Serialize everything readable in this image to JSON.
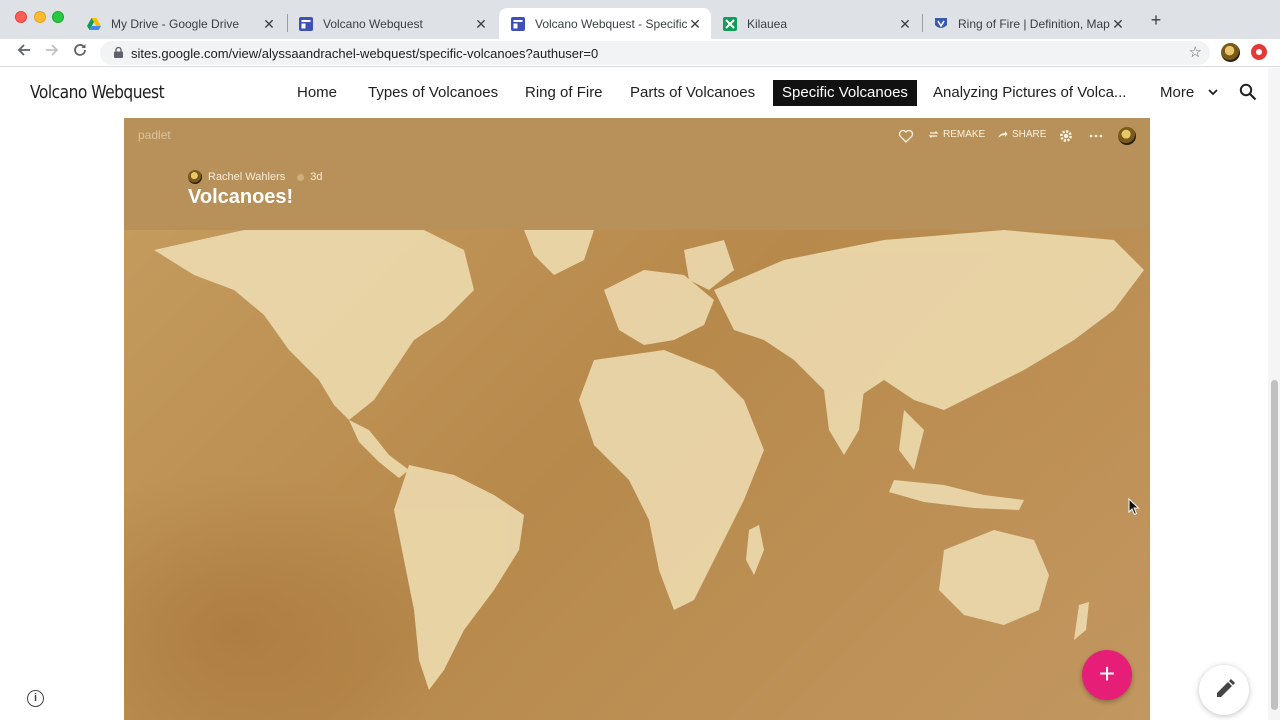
{
  "browser": {
    "tabs": [
      {
        "title": "My Drive - Google Drive",
        "icon": "google-drive-icon",
        "active": false
      },
      {
        "title": "Volcano Webquest",
        "icon": "google-sites-icon",
        "active": false
      },
      {
        "title": "Volcano Webquest - Specific V",
        "icon": "google-sites-icon",
        "active": true
      },
      {
        "title": "Kilauea",
        "icon": "google-sheets-icon",
        "active": false
      },
      {
        "title": "Ring of Fire | Definition, Map, &",
        "icon": "britannica-icon",
        "active": false
      }
    ],
    "new_tab_label": "+",
    "url": "sites.google.com/view/alyssaandrachel-webquest/specific-volcanoes?authuser=0"
  },
  "site": {
    "title": "Volcano Webquest",
    "nav": [
      {
        "label": "Home",
        "active": false
      },
      {
        "label": "Types of Volcanoes",
        "active": false
      },
      {
        "label": "Ring of Fire",
        "active": false
      },
      {
        "label": "Parts of Volcanoes",
        "active": false
      },
      {
        "label": "Specific Volcanoes",
        "active": true
      },
      {
        "label": "Analyzing Pictures of Volca...",
        "active": false
      }
    ],
    "more_label": "More"
  },
  "padlet": {
    "logo": "padlet",
    "remake_label": "REMAKE",
    "share_label": "SHARE",
    "author": "Rachel Wahlers",
    "age": "3d",
    "title": "Volcanoes!",
    "add_button": "+",
    "accent": "#e61e78",
    "header_color": "#b8915a"
  },
  "page": {
    "info_label": "i"
  }
}
